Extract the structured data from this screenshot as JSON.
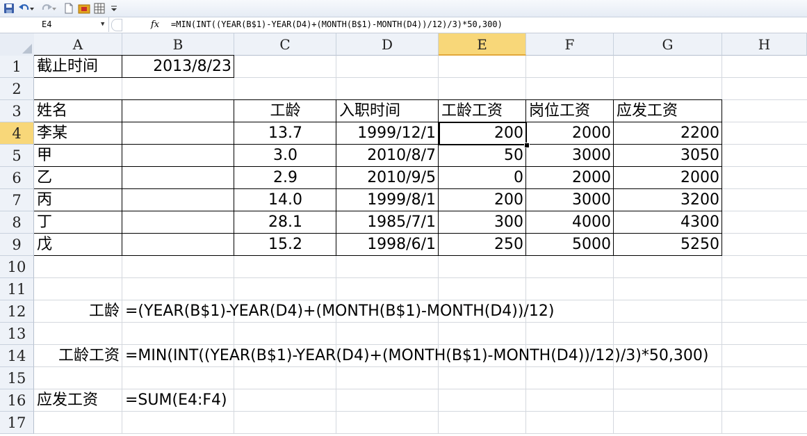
{
  "toolbar": {
    "icons": [
      "save-icon",
      "undo-icon",
      "undo-dropdown-icon",
      "redo-icon",
      "redo-dropdown-icon",
      "new-file-icon",
      "open-folder-icon",
      "print-preview-icon",
      "customize-toolbar-icon"
    ]
  },
  "formula_bar": {
    "name_box": "E4",
    "fx_label": "fx",
    "formula": "=MIN(INT((YEAR(B$1)-YEAR(D4)+(MONTH(B$1)-MONTH(D4))/12)/3)*50,300)"
  },
  "columns": [
    "A",
    "B",
    "C",
    "D",
    "E",
    "F",
    "G",
    "H"
  ],
  "rows": [
    "1",
    "2",
    "3",
    "4",
    "5",
    "6",
    "7",
    "8",
    "9",
    "10",
    "11",
    "12",
    "13",
    "14",
    "15",
    "16",
    "17"
  ],
  "selected": {
    "column": "E",
    "row": "4"
  },
  "cells": {
    "A1": "截止时间",
    "B1": "2013/8/23",
    "A3": "姓名",
    "C3": "工龄",
    "D3": "入职时间",
    "E3": "工龄工资",
    "F3": "岗位工资",
    "G3": "应发工资",
    "A12": "工龄",
    "B12": "=(YEAR(B$1)-YEAR(D4)+(MONTH(B$1)-MONTH(D4))/12)",
    "A14": "工龄工资",
    "B14": "=MIN(INT((YEAR(B$1)-YEAR(D4)+(MONTH(B$1)-MONTH(D4))/12)/3)*50,300)",
    "A16": "应发工资",
    "B16": "=SUM(E4:F4)"
  },
  "table": [
    {
      "name": "李某",
      "seniority": "13.7",
      "hire_date": "1999/12/1",
      "seniority_pay": "200",
      "post_pay": "2000",
      "total_pay": "2200"
    },
    {
      "name": "甲",
      "seniority": "3.0",
      "hire_date": "2010/8/7",
      "seniority_pay": "50",
      "post_pay": "3000",
      "total_pay": "3050"
    },
    {
      "name": "乙",
      "seniority": "2.9",
      "hire_date": "2010/9/5",
      "seniority_pay": "0",
      "post_pay": "2000",
      "total_pay": "2000"
    },
    {
      "name": "丙",
      "seniority": "14.0",
      "hire_date": "1999/8/1",
      "seniority_pay": "200",
      "post_pay": "3000",
      "total_pay": "3200"
    },
    {
      "name": "丁",
      "seniority": "28.1",
      "hire_date": "1985/7/1",
      "seniority_pay": "300",
      "post_pay": "4000",
      "total_pay": "4300"
    },
    {
      "name": "戊",
      "seniority": "15.2",
      "hire_date": "1998/6/1",
      "seniority_pay": "250",
      "post_pay": "5000",
      "total_pay": "5250"
    }
  ]
}
